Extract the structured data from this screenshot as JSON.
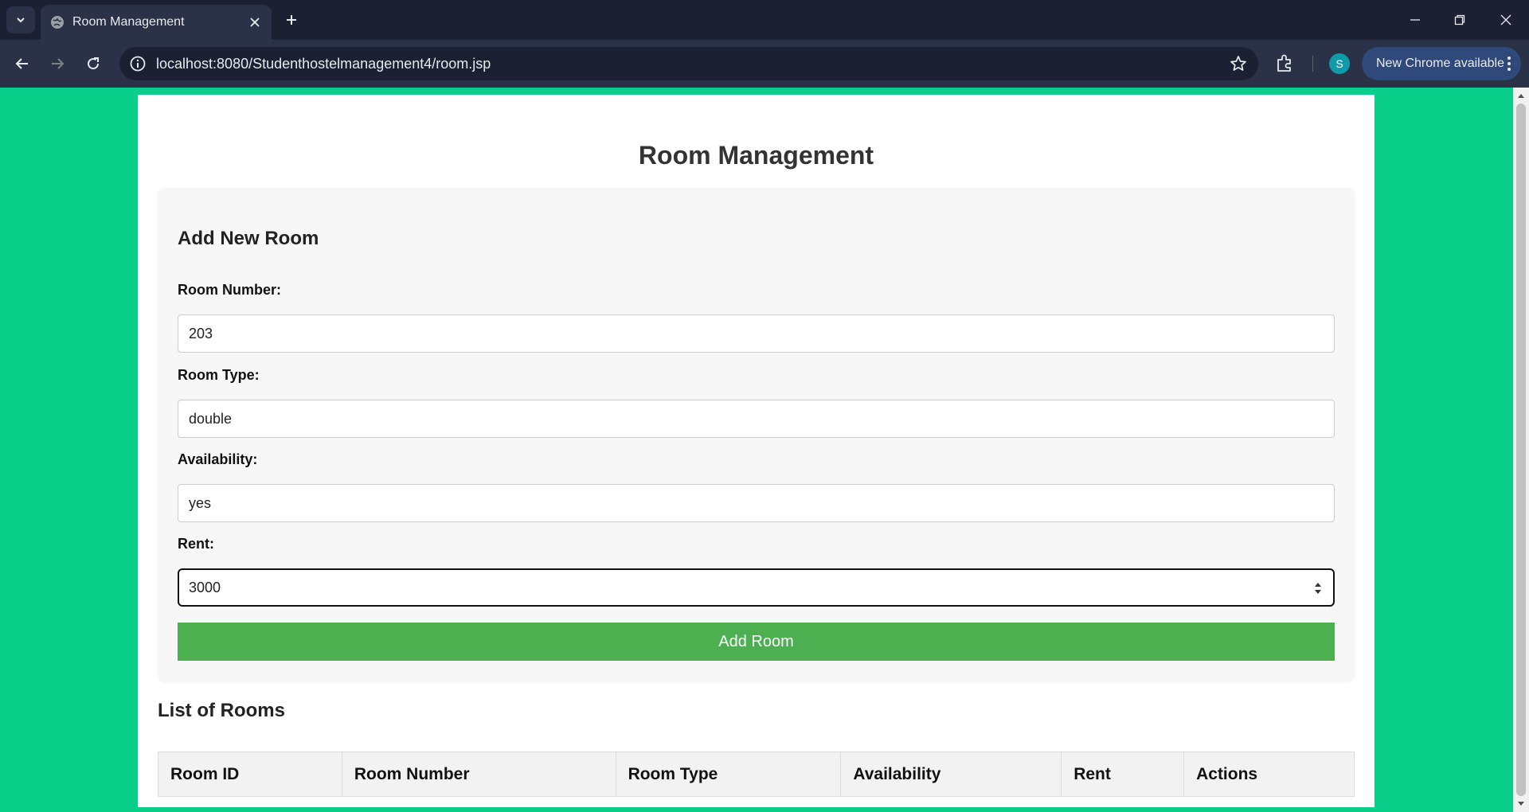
{
  "browser": {
    "tab_title": "Room Management",
    "url": "localhost:8080/Studenthostelmanagement4/room.jsp",
    "profile_initial": "S",
    "update_label": "New Chrome available"
  },
  "page": {
    "title": "Room Management",
    "form": {
      "heading": "Add New Room",
      "fields": [
        {
          "label": "Room Number:",
          "value": "203"
        },
        {
          "label": "Room Type:",
          "value": "double"
        },
        {
          "label": "Availability:",
          "value": "yes"
        },
        {
          "label": "Rent:",
          "value": "3000"
        }
      ],
      "submit_label": "Add Room"
    },
    "list": {
      "heading": "List of Rooms",
      "columns": [
        "Room ID",
        "Room Number",
        "Room Type",
        "Availability",
        "Rent",
        "Actions"
      ]
    }
  },
  "colors": {
    "page_background": "#0acf8a",
    "submit_button": "#4caf50"
  }
}
